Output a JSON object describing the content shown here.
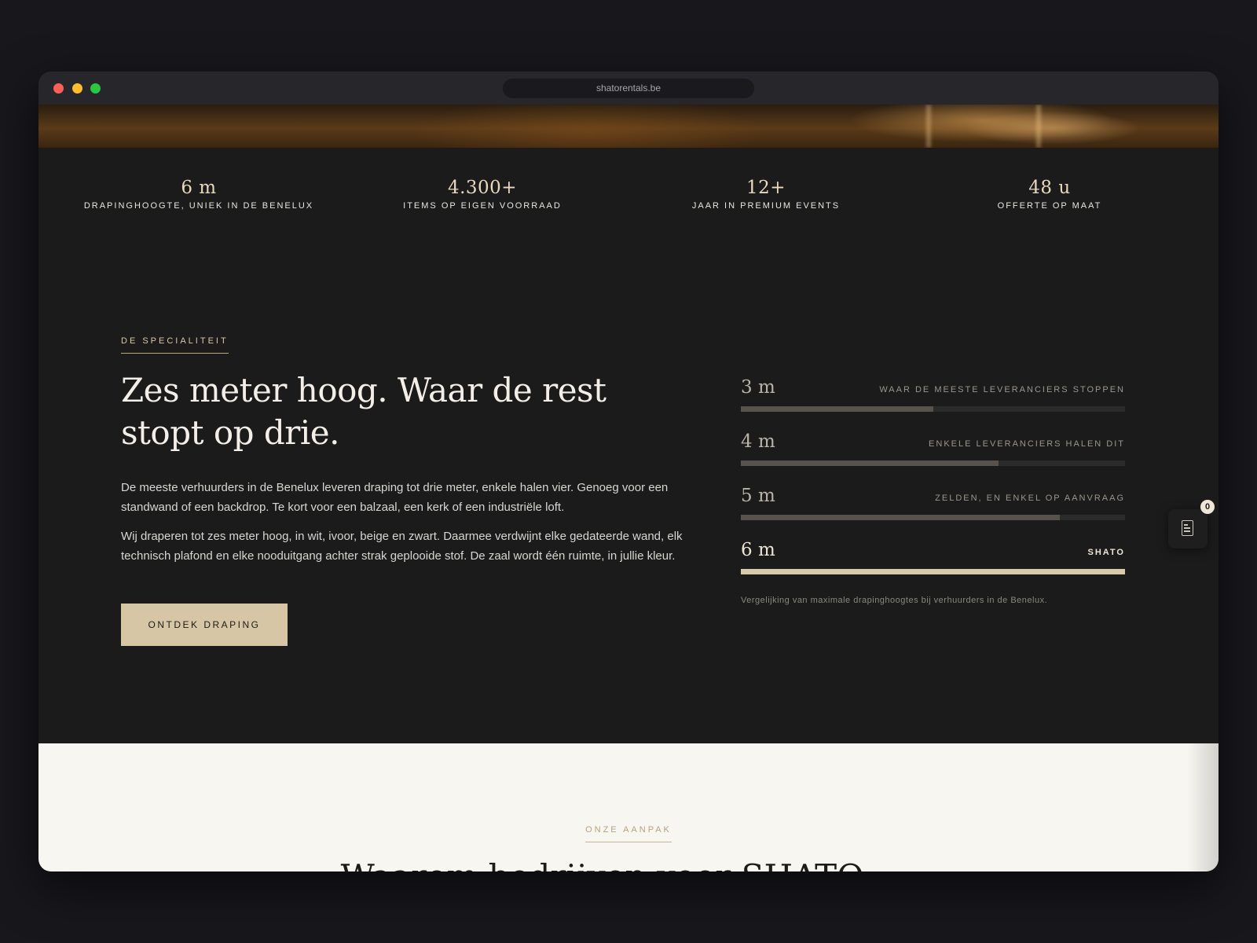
{
  "browser": {
    "url": "shatorentals.be"
  },
  "stats": [
    {
      "value": "6 m",
      "label": "DRAPINGHOOGTE, UNIEK IN DE BENELUX"
    },
    {
      "value": "4.300+",
      "label": "ITEMS OP EIGEN VOORRAAD"
    },
    {
      "value": "12+",
      "label": "JAAR IN PREMIUM EVENTS"
    },
    {
      "value": "48 u",
      "label": "OFFERTE OP MAAT"
    }
  ],
  "specialty": {
    "eyebrow": "DE SPECIALITEIT",
    "headline": "Zes meter hoog. Waar de rest stopt op drie.",
    "paragraph1": "De meeste verhuurders in de Benelux leveren draping tot drie meter, enkele halen vier. Genoeg voor een standwand of een backdrop. Te kort voor een balzaal, een kerk of een industriële loft.",
    "paragraph2": "Wij draperen tot zes meter hoog, in wit, ivoor, beige en zwart. Daarmee verdwijnt elke gedateerde wand, elk technisch plafond en elke nooduitgang achter strak geplooide stof. De zaal wordt één ruimte, in jullie kleur.",
    "cta_label": "ONTDEK DRAPING"
  },
  "comparison": {
    "rows": [
      {
        "value": "3 m",
        "note": "WAAR DE MEESTE LEVERANCIERS STOPPEN",
        "fill": 0.5
      },
      {
        "value": "4 m",
        "note": "ENKELE LEVERANCIERS HALEN DIT",
        "fill": 0.67
      },
      {
        "value": "5 m",
        "note": "ZELDEN, EN ENKEL OP AANVRAAG",
        "fill": 0.83
      },
      {
        "value": "6 m",
        "note": "SHATO",
        "fill": 1.0
      }
    ],
    "caption": "Vergelijking van maximale drapinghoogtes bij verhuurders in de Benelux."
  },
  "quote_widget": {
    "icon": "document-icon",
    "count": "0"
  },
  "approach": {
    "eyebrow": "ONZE AANPAK",
    "heading_partial": "Waarom bedrijven voor SHATO ...."
  },
  "colors": {
    "accent": "#d6c6a5",
    "dark_bg": "#1b1b1b",
    "light_bg": "#f8f6f1"
  }
}
